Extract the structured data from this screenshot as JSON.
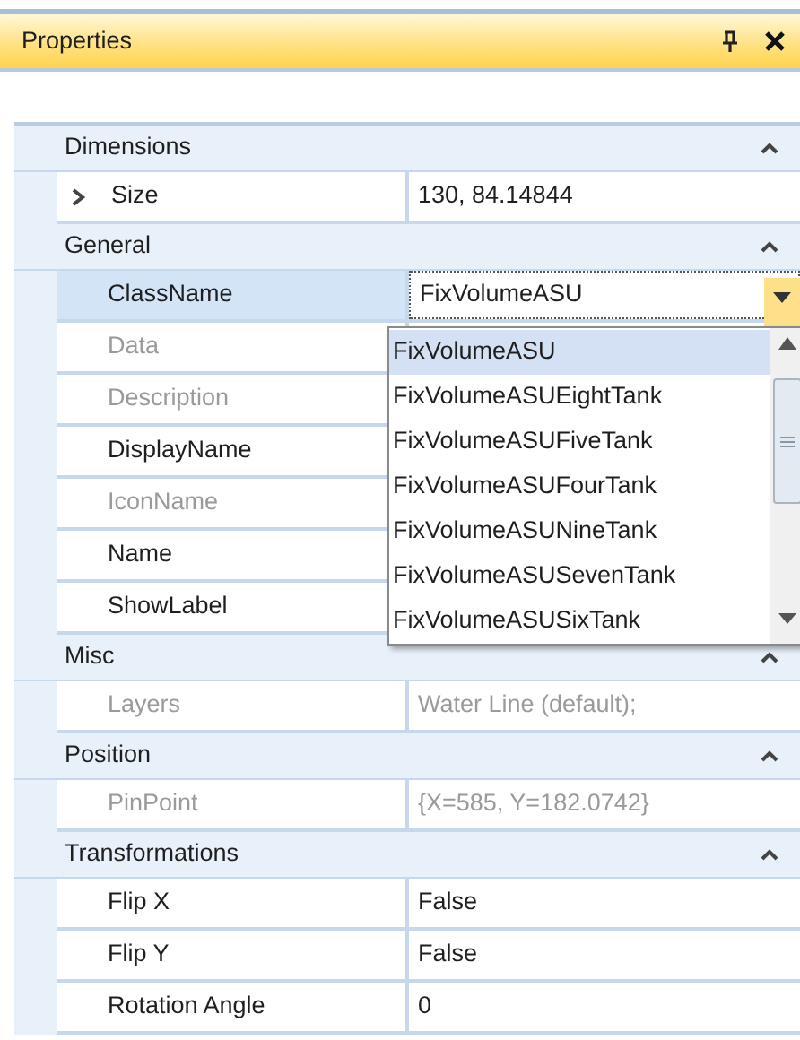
{
  "window": {
    "title": "Properties"
  },
  "categories": [
    {
      "label": "Dimensions",
      "expanded": true,
      "properties": [
        {
          "name": "Size",
          "value": "130, 84.14844",
          "disabled": false,
          "selected": false,
          "expandable": true
        }
      ]
    },
    {
      "label": "General",
      "expanded": true,
      "properties": [
        {
          "name": "ClassName",
          "value": "FixVolumeASU",
          "disabled": false,
          "selected": true,
          "expandable": false
        },
        {
          "name": "Data",
          "disabled": true,
          "selected": false,
          "expandable": false
        },
        {
          "name": "Description",
          "disabled": true,
          "selected": false,
          "expandable": false
        },
        {
          "name": "DisplayName",
          "disabled": false,
          "selected": false,
          "expandable": false
        },
        {
          "name": "IconName",
          "disabled": true,
          "selected": false,
          "expandable": false
        },
        {
          "name": "Name",
          "disabled": false,
          "selected": false,
          "expandable": false
        },
        {
          "name": "ShowLabel",
          "disabled": false,
          "selected": false,
          "expandable": false
        }
      ]
    },
    {
      "label": "Misc",
      "expanded": true,
      "properties": [
        {
          "name": "Layers",
          "value": "Water Line (default);",
          "disabled": true,
          "selected": false,
          "expandable": false
        }
      ]
    },
    {
      "label": "Position",
      "expanded": true,
      "properties": [
        {
          "name": "PinPoint",
          "value": "{X=585, Y=182.0742}",
          "disabled": true,
          "selected": false,
          "expandable": false
        }
      ]
    },
    {
      "label": "Transformations",
      "expanded": true,
      "properties": [
        {
          "name": "Flip X",
          "value": "False",
          "disabled": false,
          "selected": false,
          "expandable": false
        },
        {
          "name": "Flip Y",
          "value": "False",
          "disabled": false,
          "selected": false,
          "expandable": false
        },
        {
          "name": "Rotation Angle",
          "value": "0",
          "disabled": false,
          "selected": false,
          "expandable": false
        }
      ]
    }
  ],
  "dropdown": {
    "items": [
      {
        "label": "FixVolumeASU",
        "selected": true
      },
      {
        "label": "FixVolumeASUEightTank",
        "selected": false
      },
      {
        "label": "FixVolumeASUFiveTank",
        "selected": false
      },
      {
        "label": "FixVolumeASUFourTank",
        "selected": false
      },
      {
        "label": "FixVolumeASUNineTank",
        "selected": false
      },
      {
        "label": "FixVolumeASUSevenTank",
        "selected": false
      },
      {
        "label": "FixVolumeASUSixTank",
        "selected": false
      }
    ]
  }
}
